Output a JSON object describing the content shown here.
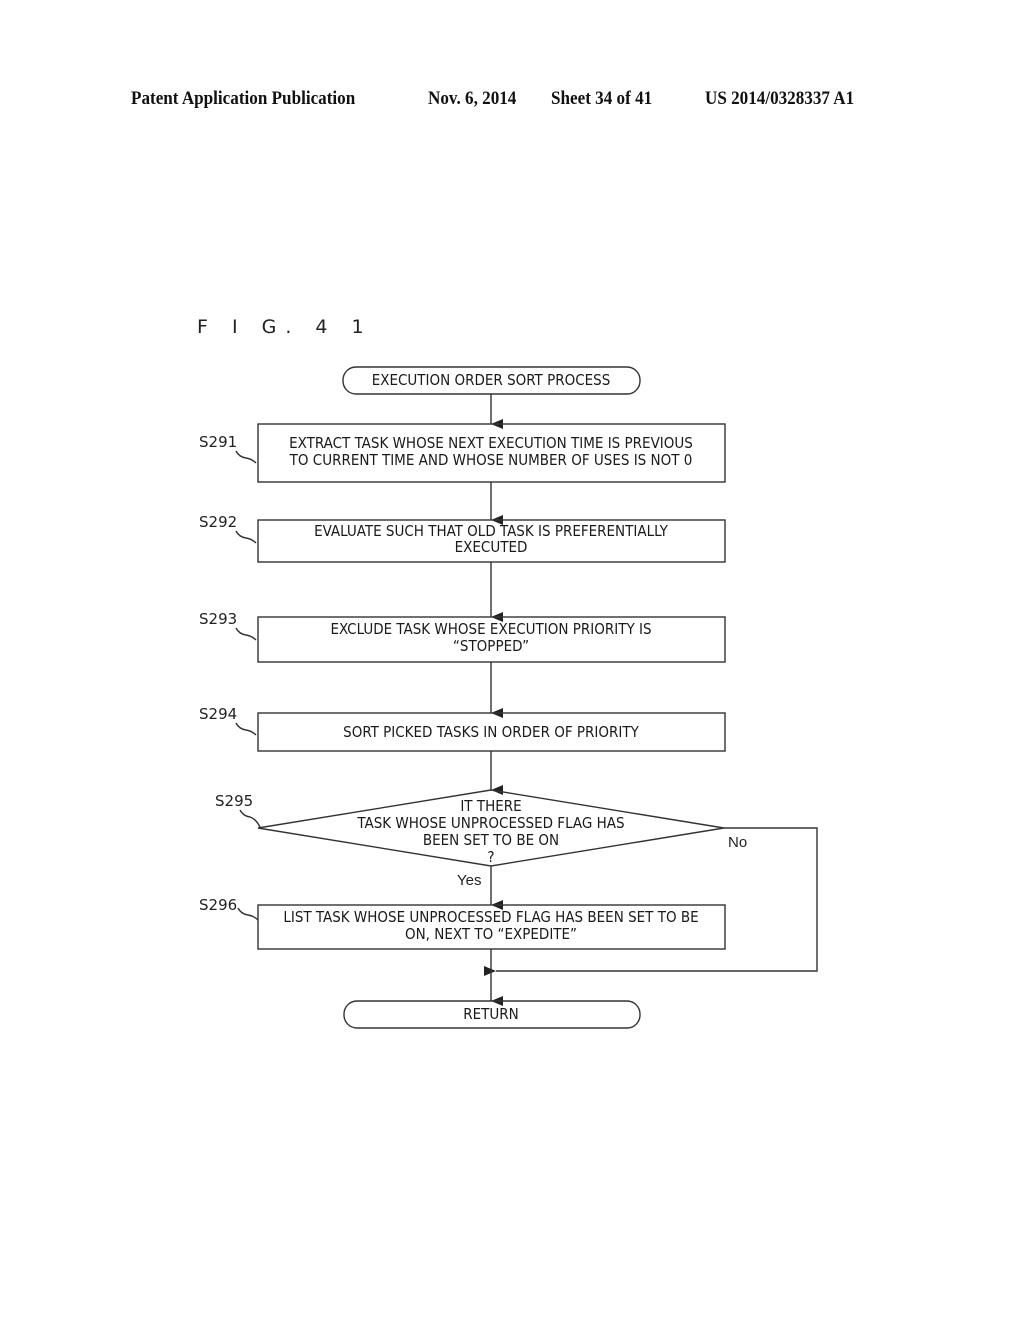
{
  "header": {
    "publication": "Patent Application Publication",
    "date": "Nov. 6, 2014",
    "sheet": "Sheet 34 of 41",
    "number": "US 2014/0328337 A1"
  },
  "figure": {
    "label": "F I G. 4 1"
  },
  "flowchart": {
    "start": {
      "text": "EXECUTION ORDER SORT PROCESS"
    },
    "steps": [
      {
        "id": "S291",
        "lines": [
          "EXTRACT TASK WHOSE NEXT EXECUTION TIME IS PREVIOUS",
          "TO CURRENT TIME AND WHOSE NUMBER OF USES IS NOT 0"
        ]
      },
      {
        "id": "S292",
        "lines": [
          "EVALUATE SUCH THAT OLD TASK IS PREFERENTIALLY",
          "EXECUTED"
        ]
      },
      {
        "id": "S293",
        "lines": [
          "EXCLUDE TASK WHOSE EXECUTION PRIORITY IS",
          "“STOPPED”"
        ]
      },
      {
        "id": "S294",
        "lines": [
          "SORT PICKED TASKS IN ORDER OF PRIORITY"
        ]
      }
    ],
    "decision": {
      "id": "S295",
      "lines": [
        "IT THERE",
        "TASK WHOSE UNPROCESSED FLAG HAS",
        "BEEN SET TO BE ON",
        "?"
      ],
      "yes_label": "Yes",
      "no_label": "No"
    },
    "final_step": {
      "id": "S296",
      "lines": [
        "LIST TASK WHOSE UNPROCESSED FLAG HAS BEEN SET TO BE",
        "ON, NEXT TO  “EXPEDITE”"
      ]
    },
    "end": {
      "text": "RETURN"
    }
  }
}
